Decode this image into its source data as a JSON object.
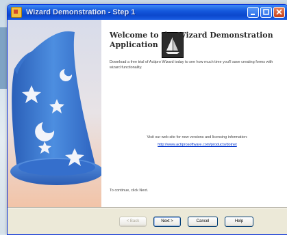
{
  "window": {
    "title": "Wizard Demonstration - Step 1"
  },
  "content": {
    "heading": "Welcome to the Wizard Demonstration Application",
    "description": "Download a free trial of Actipro Wizard today to see how much time you'll save creating forms with wizard functionality.",
    "visit_text": "Visit our web site for new versions and licensing information:",
    "link": "http://www.actiprosoftware.com/products/dotnet",
    "continue_text": "To continue, click Next."
  },
  "buttons": {
    "back": "< Back",
    "next": "Next >",
    "cancel": "Cancel",
    "help": "Help"
  },
  "icons": {
    "left_art": "wizard-hat-icon",
    "logo": "sailboat-logo-icon"
  },
  "colors": {
    "titlebar": "#0c47cc",
    "hat_blue": "#3f7fd8",
    "link": "#0033cc"
  }
}
